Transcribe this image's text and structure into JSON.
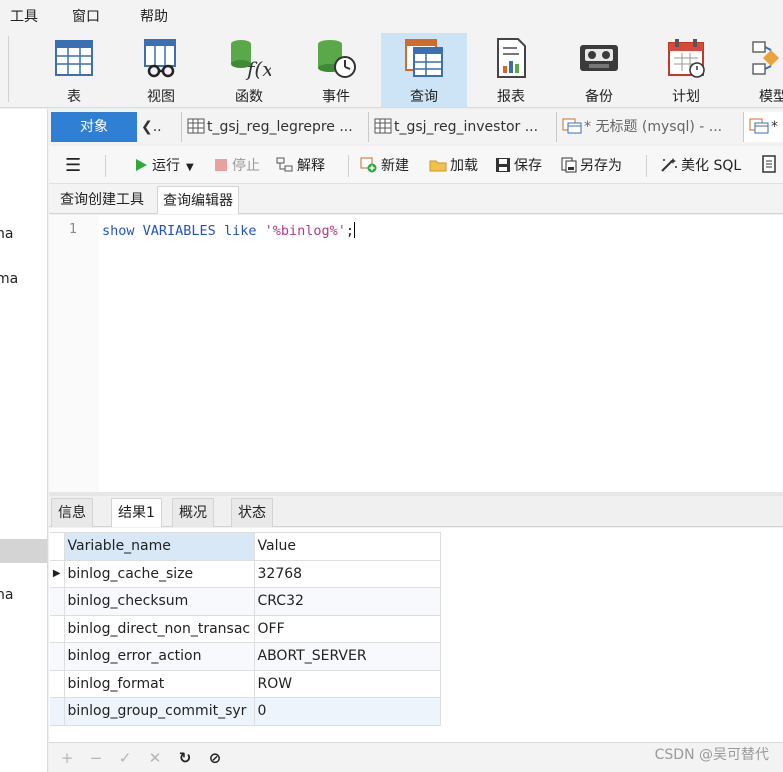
{
  "menu": {
    "tools": "工具",
    "window": "窗口",
    "help": "帮助"
  },
  "toolbar": {
    "items": [
      {
        "label": "表"
      },
      {
        "label": "视图"
      },
      {
        "label": "函数"
      },
      {
        "label": "事件"
      },
      {
        "label": "查询",
        "active": true
      },
      {
        "label": "报表"
      },
      {
        "label": "备份"
      },
      {
        "label": "计划"
      },
      {
        "label": "模型"
      }
    ]
  },
  "left_panel": {
    "fragments": [
      "na",
      "ma",
      "na"
    ]
  },
  "tabs": {
    "objects": "对象",
    "overflow": "..",
    "docs": [
      "t_gsj_reg_legrepre ...",
      "t_gsj_reg_investor ...",
      "* 无标题 (mysql) - ...",
      "*"
    ]
  },
  "query_toolbar": {
    "run": "运行",
    "stop": "停止",
    "explain": "解释",
    "new": "新建",
    "load": "加载",
    "save": "保存",
    "save_as": "另存为",
    "beautify": "美化 SQL"
  },
  "sub_tabs": {
    "builder": "查询创建工具",
    "editor": "查询编辑器"
  },
  "editor": {
    "line_number": "1",
    "code": {
      "kw1": "show",
      "kw2": "VARIABLES",
      "kw3": "like",
      "str": "'%binlog%'",
      "end": ";"
    }
  },
  "result_tabs": {
    "info": "信息",
    "result": "结果1",
    "profile": "概况",
    "status": "状态"
  },
  "grid": {
    "columns": [
      "Variable_name",
      "Value"
    ],
    "rows": [
      {
        "name": "binlog_cache_size",
        "value": "32768"
      },
      {
        "name": "binlog_checksum",
        "value": "CRC32"
      },
      {
        "name": "binlog_direct_non_transac",
        "value": "OFF"
      },
      {
        "name": "binlog_error_action",
        "value": "ABORT_SERVER"
      },
      {
        "name": "binlog_format",
        "value": "ROW"
      },
      {
        "name": "binlog_group_commit_syr",
        "value": "0"
      }
    ]
  },
  "bottom_bar": {
    "add": "+",
    "remove": "−",
    "apply": "✓",
    "discard": "✕",
    "refresh": "↻",
    "stop": "⊘"
  },
  "watermark": "CSDN @吴可替代"
}
